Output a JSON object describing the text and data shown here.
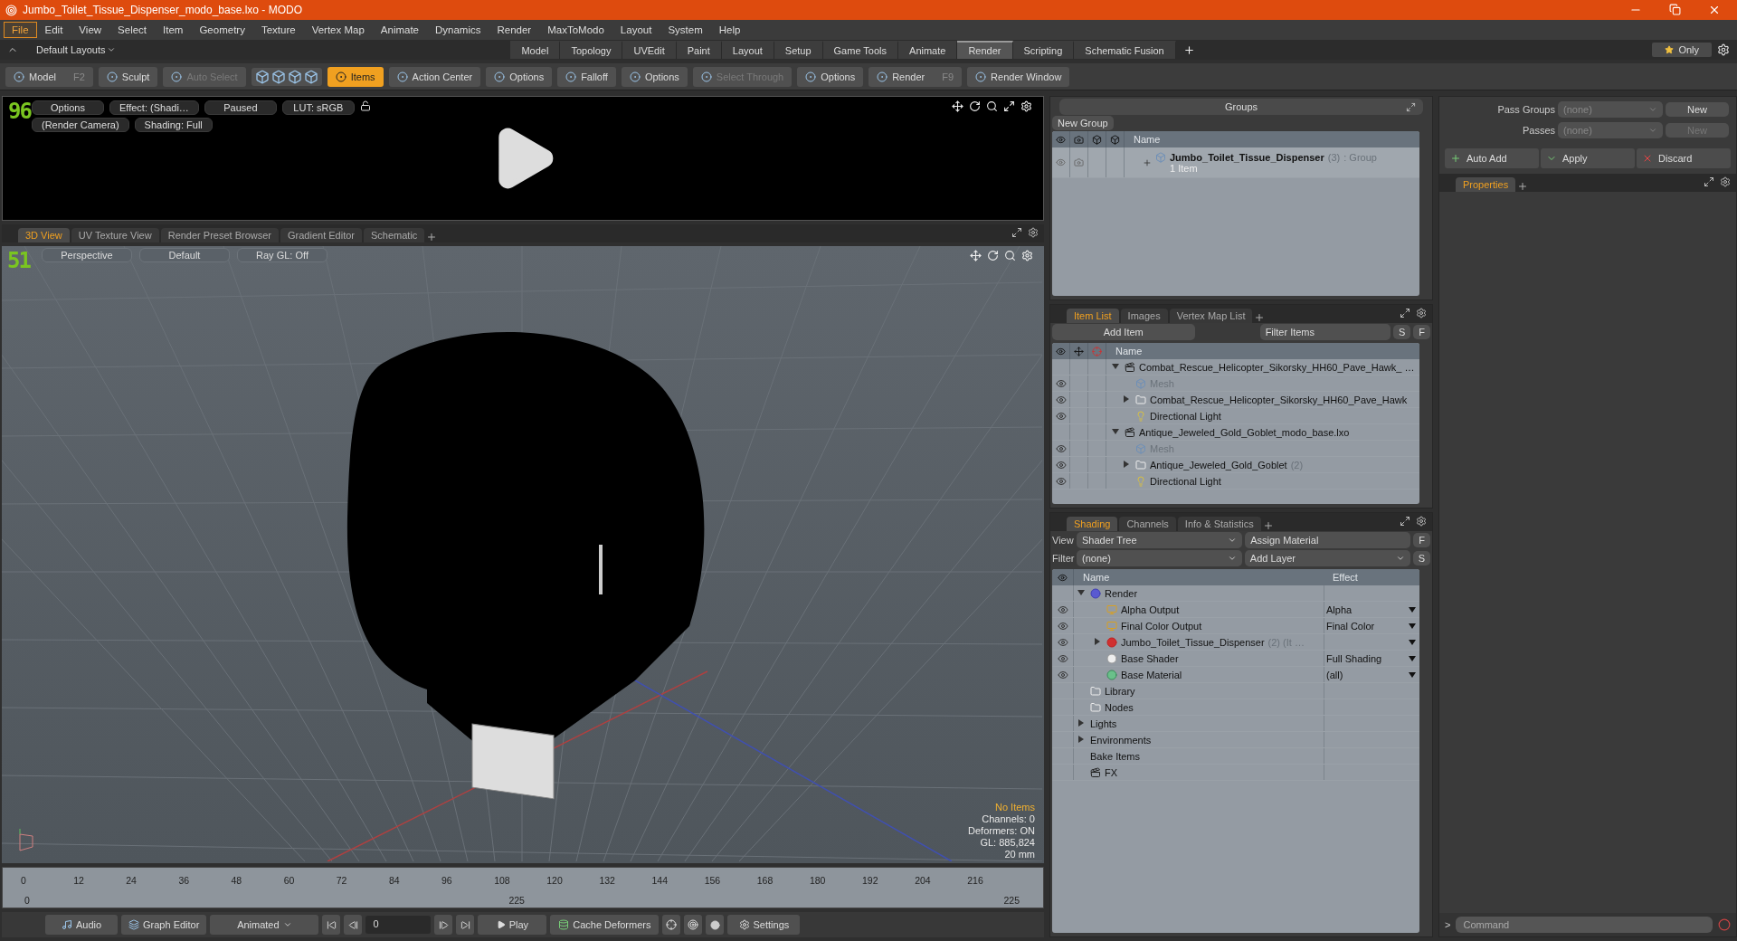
{
  "window": {
    "title": "Jumbo_Toilet_Tissue_Dispenser_modo_base.lxo - MODO"
  },
  "menu": [
    {
      "label": "File",
      "selected": true
    },
    {
      "label": "Edit",
      "selected": false
    },
    {
      "label": "View",
      "selected": false
    },
    {
      "label": "Select",
      "selected": false
    },
    {
      "label": "Item",
      "selected": false
    },
    {
      "label": "Geometry",
      "selected": false
    },
    {
      "label": "Texture",
      "selected": false
    },
    {
      "label": "Vertex Map",
      "selected": false
    },
    {
      "label": "Animate",
      "selected": false
    },
    {
      "label": "Dynamics",
      "selected": false
    },
    {
      "label": "Render",
      "selected": false
    },
    {
      "label": "MaxToModo",
      "selected": false
    },
    {
      "label": "Layout",
      "selected": false
    },
    {
      "label": "System",
      "selected": false
    },
    {
      "label": "Help",
      "selected": false
    }
  ],
  "layouts_menu": "Default Layouts",
  "layout_tabs": [
    {
      "label": "Model",
      "selected": false
    },
    {
      "label": "Topology",
      "selected": false
    },
    {
      "label": "UVEdit",
      "selected": false
    },
    {
      "label": "Paint",
      "selected": false
    },
    {
      "label": "Layout",
      "selected": false
    },
    {
      "label": "Setup",
      "selected": false
    },
    {
      "label": "Game Tools",
      "selected": false
    },
    {
      "label": "Animate",
      "selected": false
    },
    {
      "label": "Render",
      "selected": true
    },
    {
      "label": "Scripting",
      "selected": false
    },
    {
      "label": "Schematic Fusion",
      "selected": false
    }
  ],
  "only_button": "Only",
  "toolbar": [
    {
      "kind": "mode",
      "label": "Model",
      "shortcut": "F2",
      "selected": false,
      "disabled": false
    },
    {
      "kind": "mode",
      "label": "Sculpt",
      "selected": false,
      "disabled": false
    },
    {
      "kind": "mode",
      "label": "Auto Select",
      "selected": false,
      "disabled": true
    },
    {
      "kind": "icons"
    },
    {
      "kind": "mode",
      "label": "Items",
      "selected": true,
      "disabled": false
    },
    {
      "kind": "mode",
      "label": "Action Center",
      "selected": false,
      "disabled": false
    },
    {
      "kind": "mode",
      "label": "Options",
      "selected": false,
      "disabled": false
    },
    {
      "kind": "mode",
      "label": "Falloff",
      "selected": false,
      "disabled": false
    },
    {
      "kind": "mode",
      "label": "Options",
      "selected": false,
      "disabled": false
    },
    {
      "kind": "mode",
      "label": "Select Through",
      "selected": false,
      "disabled": true
    },
    {
      "kind": "mode",
      "label": "Options",
      "selected": false,
      "disabled": false
    },
    {
      "kind": "mode",
      "label": "Render",
      "shortcut": "F9",
      "selected": false,
      "disabled": false
    },
    {
      "kind": "mode",
      "label": "Render Window",
      "selected": false,
      "disabled": false
    }
  ],
  "render_view": {
    "counter": "96",
    "buttons": [
      [
        "Options",
        "Effect: (Shadi…",
        "Paused",
        "LUT: sRGB"
      ],
      [
        "(Render Camera)",
        "Shading: Full"
      ]
    ]
  },
  "viewport_tabs": [
    {
      "label": "3D View",
      "selected": true
    },
    {
      "label": "UV Texture View",
      "selected": false
    },
    {
      "label": "Render Preset Browser",
      "selected": false
    },
    {
      "label": "Gradient Editor",
      "selected": false
    },
    {
      "label": "Schematic",
      "selected": false
    }
  ],
  "viewport": {
    "counter": "51",
    "buttons": [
      "Perspective",
      "Default",
      "Ray GL: Off"
    ],
    "info": [
      {
        "text": "No Items",
        "highlighted": true
      },
      {
        "text": "Channels: 0",
        "highlighted": false
      },
      {
        "text": "Deformers: ON",
        "highlighted": false
      },
      {
        "text": "GL: 885,824",
        "highlighted": false
      },
      {
        "text": "20 mm",
        "highlighted": false
      }
    ]
  },
  "timeline": {
    "ticks": [
      "0",
      "12",
      "24",
      "36",
      "48",
      "60",
      "72",
      "84",
      "96",
      "108",
      "120",
      "132",
      "144",
      "156",
      "168",
      "180",
      "192",
      "204",
      "216"
    ],
    "start": "0",
    "middle": "225",
    "end": "225"
  },
  "transport": {
    "audio": "Audio",
    "graph_editor": "Graph Editor",
    "mode": "Animated",
    "frame": "0",
    "play": "Play",
    "cache": "Cache Deformers",
    "settings": "Settings"
  },
  "groups": {
    "title": "Groups",
    "new_group": "New Group",
    "column": "Name",
    "rows": [
      {
        "name": "Jumbo_Toilet_Tissue_Dispenser",
        "count": "(3)",
        "type": ": Group",
        "sub": "1 Item"
      }
    ]
  },
  "passes": {
    "rows": [
      {
        "label": "Pass Groups",
        "value": "(none)",
        "button": "New",
        "disabled": false
      },
      {
        "label": "Passes",
        "value": "(none)",
        "button": "New",
        "disabled": true
      }
    ],
    "actions": [
      {
        "kind": "add",
        "label": "Auto Add"
      },
      {
        "kind": "apply",
        "label": "Apply"
      },
      {
        "kind": "discard",
        "label": "Discard"
      }
    ],
    "tab": "Properties"
  },
  "item_list": {
    "tabs": [
      {
        "label": "Item List",
        "selected": true
      },
      {
        "label": "Images",
        "selected": false
      },
      {
        "label": "Vertex Map List",
        "selected": false
      }
    ],
    "add_item": "Add Item",
    "filter_placeholder": "Filter Items",
    "s": "S",
    "f": "F",
    "column": "Name",
    "items": [
      {
        "kind": "scene",
        "name": "Combat_Rescue_Helicopter_Sikorsky_HH60_Pave_Hawk_ …",
        "expanded": true,
        "children": [
          {
            "kind": "mesh",
            "name": "Mesh",
            "visible": true,
            "dimmed": true
          },
          {
            "kind": "group",
            "name": "Combat_Rescue_Helicopter_Sikorsky_HH60_Pave_Hawk",
            "visible": true,
            "expanded": false
          },
          {
            "kind": "light",
            "name": "Directional Light",
            "visible": true
          }
        ]
      },
      {
        "kind": "scene",
        "name": "Antique_Jeweled_Gold_Goblet_modo_base.lxo",
        "expanded": true,
        "children": [
          {
            "kind": "mesh",
            "name": "Mesh",
            "visible": true,
            "dimmed": true
          },
          {
            "kind": "group",
            "name": "Antique_Jeweled_Gold_Goblet",
            "count": "(2)",
            "visible": true,
            "expanded": false
          },
          {
            "kind": "light",
            "name": "Directional Light",
            "visible": true
          }
        ]
      }
    ]
  },
  "shading": {
    "tabs": [
      {
        "label": "Shading",
        "selected": true
      },
      {
        "label": "Channels",
        "selected": false
      },
      {
        "label": "Info & Statistics",
        "selected": false
      }
    ],
    "view_label": "View",
    "view": "Shader Tree",
    "assign": "Assign Material",
    "f": "F",
    "filter_label": "Filter",
    "filter": "(none)",
    "add_layer": "Add Layer",
    "s": "S",
    "columns": [
      "Name",
      "Effect"
    ],
    "items": [
      {
        "kind": "render",
        "name": "Render",
        "expanded": true,
        "children": [
          {
            "kind": "output",
            "name": "Alpha Output",
            "effect": "Alpha",
            "effect_menu": true,
            "visible": true
          },
          {
            "kind": "output",
            "name": "Final Color Output",
            "effect": "Final Color",
            "effect_menu": true,
            "visible": true
          },
          {
            "kind": "material",
            "name": "Jumbo_Toilet_Tissue_Dispenser",
            "count": "(2) (It …",
            "effect_menu": true,
            "visible": true,
            "expanded": false
          },
          {
            "kind": "shader",
            "name": "Base Shader",
            "effect": "Full Shading",
            "effect_menu": true,
            "visible": true
          },
          {
            "kind": "basematerial",
            "name": "Base Material",
            "effect": "(all)",
            "effect_menu": true,
            "visible": true
          }
        ]
      },
      {
        "kind": "folder",
        "name": "Library"
      },
      {
        "kind": "folder",
        "name": "Nodes"
      },
      {
        "kind": "none",
        "name": "Lights",
        "expanded": false
      },
      {
        "kind": "none",
        "name": "Environments",
        "expanded": false
      },
      {
        "kind": "none",
        "name": "Bake Items"
      },
      {
        "kind": "fx",
        "name": "FX"
      }
    ]
  },
  "command": {
    "prompt": ">",
    "placeholder": "Command"
  }
}
